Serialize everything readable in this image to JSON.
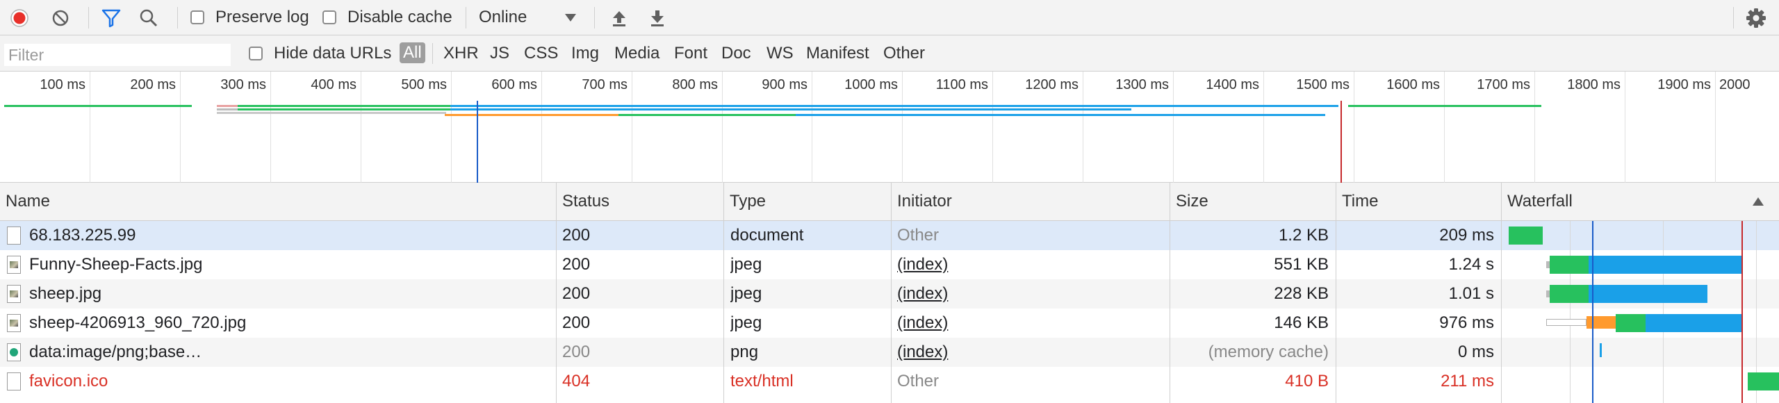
{
  "toolbar": {
    "preserve_log_label": "Preserve log",
    "disable_cache_label": "Disable cache",
    "throttling_value": "Online",
    "colors": {
      "record": "#e8302a",
      "filter_active": "#1a73e8"
    }
  },
  "filterbar": {
    "placeholder": "Filter",
    "hide_data_urls_label": "Hide data URLs",
    "types": [
      "All",
      "XHR",
      "JS",
      "CSS",
      "Img",
      "Media",
      "Font",
      "Doc",
      "WS",
      "Manifest",
      "Other"
    ],
    "active_type": "All"
  },
  "overview": {
    "ticks": [
      "100 ms",
      "200 ms",
      "300 ms",
      "400 ms",
      "500 ms",
      "600 ms",
      "700 ms",
      "800 ms",
      "900 ms",
      "1000 ms",
      "1100 ms",
      "1200 ms",
      "1300 ms",
      "1400 ms",
      "1500 ms",
      "1600 ms",
      "1700 ms",
      "1800 ms",
      "1900 ms",
      "2000"
    ]
  },
  "table": {
    "headers": {
      "name": "Name",
      "status": "Status",
      "type": "Type",
      "initiator": "Initiator",
      "size": "Size",
      "time": "Time",
      "waterfall": "Waterfall"
    },
    "rows": [
      {
        "name": "68.183.225.99",
        "status": "200",
        "type": "document",
        "initiator": "Other",
        "size": "1.2 KB",
        "time": "209 ms",
        "icon": "document-icon"
      },
      {
        "name": "Funny-Sheep-Facts.jpg",
        "status": "200",
        "type": "jpeg",
        "initiator": "(index)",
        "size": "551 KB",
        "time": "1.24 s",
        "icon": "image-icon"
      },
      {
        "name": "sheep.jpg",
        "status": "200",
        "type": "jpeg",
        "initiator": "(index)",
        "size": "228 KB",
        "time": "1.01 s",
        "icon": "image-icon"
      },
      {
        "name": "sheep-4206913_960_720.jpg",
        "status": "200",
        "type": "jpeg",
        "initiator": "(index)",
        "size": "146 KB",
        "time": "976 ms",
        "icon": "image-icon"
      },
      {
        "name": "data:image/png;base…",
        "status": "200",
        "type": "png",
        "initiator": "(index)",
        "size": "(memory cache)",
        "time": "0 ms",
        "icon": "data-image-icon"
      },
      {
        "name": "favicon.ico",
        "status": "404",
        "type": "text/html",
        "initiator": "Other",
        "size": "410 B",
        "time": "211 ms",
        "icon": "document-icon"
      }
    ]
  },
  "colors": {
    "selected_row": "#dde9f9",
    "alt_row": "#f5f5f5",
    "error_text": "#d93025",
    "dim_text": "#888888",
    "waiting": "#27c15e",
    "download": "#1aa0e8",
    "stalled": "#ff9a2e",
    "dom_content_loaded": "#1a5cc8",
    "load": "#c6282b"
  }
}
